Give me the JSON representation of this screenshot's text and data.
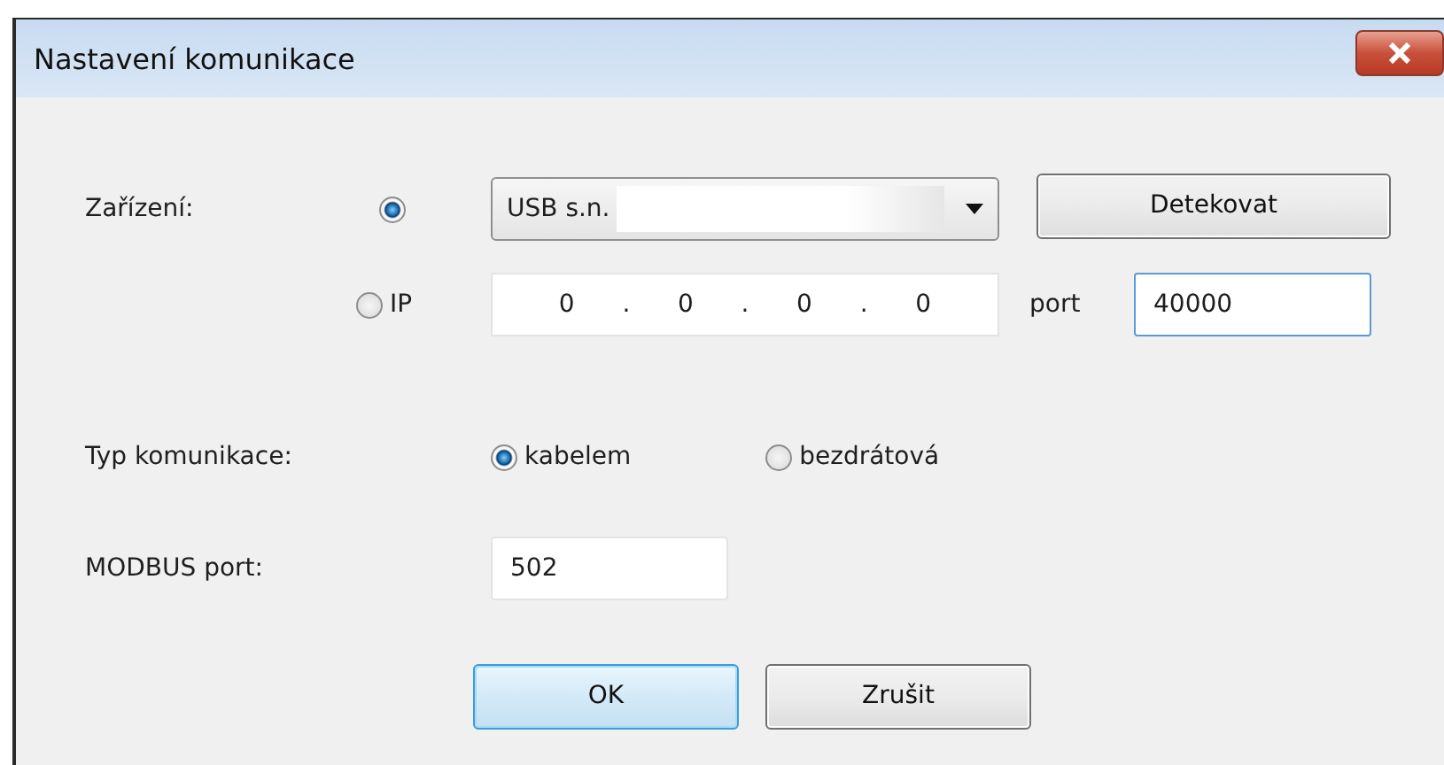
{
  "window": {
    "title": "Nastavení komunikace"
  },
  "device": {
    "label": "Zařízení:",
    "options": [
      {
        "kind": "usb",
        "selected": true,
        "value": "USB s.n."
      },
      {
        "kind": "ip",
        "selected": false,
        "label": "IP",
        "octets": [
          "0",
          "0",
          "0",
          "0"
        ],
        "separator": "."
      }
    ],
    "detect_button": "Detekovat",
    "port": {
      "label": "port",
      "value": "40000",
      "focused": true
    }
  },
  "communication_type": {
    "label": "Typ komunikace:",
    "options": [
      {
        "label": "kabelem",
        "selected": true
      },
      {
        "label": "bezdrátová",
        "selected": false
      }
    ]
  },
  "modbus": {
    "label": "MODBUS port:",
    "value": "502"
  },
  "buttons": [
    {
      "label": "OK",
      "default": true
    },
    {
      "label": "Zrušit",
      "default": false
    }
  ]
}
